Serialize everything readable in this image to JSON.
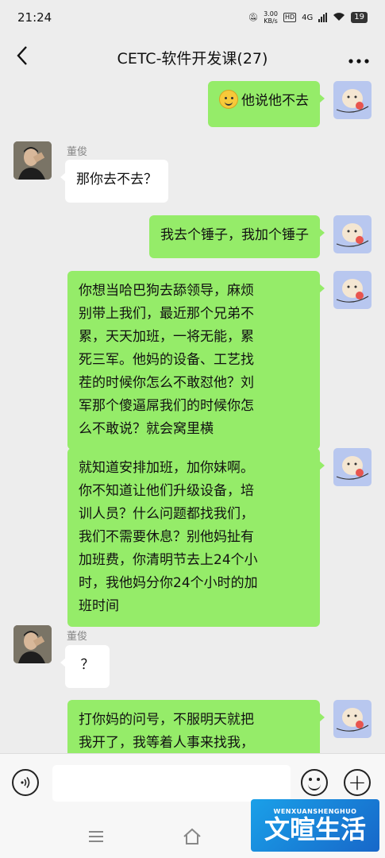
{
  "status_bar": {
    "time": "21:24",
    "speed_value": "3.00",
    "speed_unit": "KB/s",
    "hd": "HD",
    "network": "4G",
    "battery": "19"
  },
  "header": {
    "title": "CETC-软件开发课(27)",
    "back_icon": "chevron-left-icon",
    "more_icon": "more-dots-icon"
  },
  "messages": [
    {
      "from": "me",
      "text": "他说他不去",
      "emoji": "smile-emoji-icon"
    },
    {
      "from": "other",
      "sender": "董俊",
      "text": "那你去不去？"
    },
    {
      "from": "me",
      "text": "我去个锤子，我加个锤子"
    },
    {
      "from": "me",
      "lines": [
        "你想当哈巴狗去舔领导，麻烦",
        "别带上我们，最近那个兄弟不",
        "累，天天加班，一将无能，累",
        "死三军。他妈的设备、工艺找",
        "茬的时候你怎么不敢怼他？刘",
        "军那个傻逼屌我们的时候你怎",
        "么不敢说？就会窝里横"
      ]
    },
    {
      "from": "me",
      "lines": [
        "就知道安排加班，加你妹啊。",
        "你不知道让他们升级设备，培",
        "训人员？什么问题都找我们，",
        "我们不需要休息？别他妈扯有",
        "加班费，你清明节去上24个小",
        "时，我他妈分你24个小时的加",
        "班时间"
      ]
    },
    {
      "from": "other",
      "sender": "董俊",
      "text": "？"
    },
    {
      "from": "me",
      "lines": [
        "打你妈的问号，不服明天就把",
        "我开了，我等着人事来找我，"
      ]
    }
  ],
  "input_bar": {
    "voice_icon": "voice-icon",
    "input_value": "",
    "emoji_icon": "emoji-icon",
    "plus_icon": "plus-icon"
  },
  "watermark": {
    "small": "WENXUANSHENGHUO",
    "big": "文暄生活"
  },
  "colors": {
    "bubble_me": "#95ec69",
    "bubble_other": "#ffffff",
    "background": "#ededed"
  }
}
